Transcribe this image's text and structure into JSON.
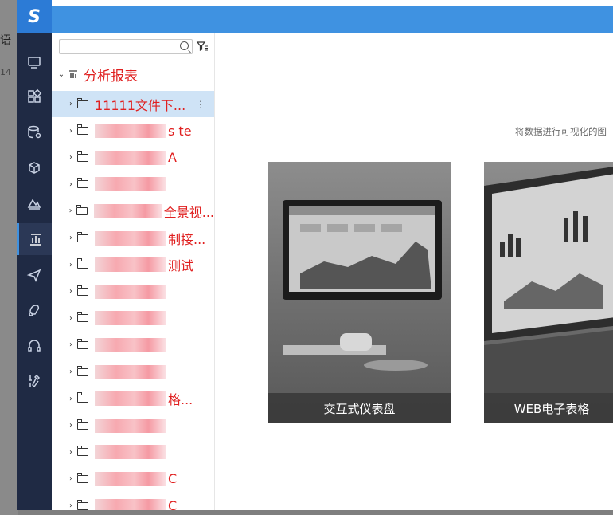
{
  "backdrop": {
    "glyph": "语",
    "small": "14"
  },
  "logo": {
    "text": "S"
  },
  "nav": [
    {
      "icon": "monitor-icon"
    },
    {
      "icon": "grid-icon"
    },
    {
      "icon": "database-icon"
    },
    {
      "icon": "cube-icon"
    },
    {
      "icon": "mountain-icon"
    },
    {
      "icon": "bar-chart-icon"
    },
    {
      "icon": "send-icon"
    },
    {
      "icon": "hand-icon"
    },
    {
      "icon": "headset-icon"
    },
    {
      "icon": "tools-icon"
    }
  ],
  "tree": {
    "search_value": "",
    "root_label": "分析报表",
    "items": [
      {
        "label": "11111文件下...",
        "selected": true
      },
      {
        "label": "s  te"
      },
      {
        "label": "A"
      },
      {
        "label": ""
      },
      {
        "label": "全景视..."
      },
      {
        "label": "制接..."
      },
      {
        "label": "测试"
      },
      {
        "label": ""
      },
      {
        "label": ""
      },
      {
        "label": ""
      },
      {
        "label": ""
      },
      {
        "label": "格..."
      },
      {
        "label": ""
      },
      {
        "label": ""
      },
      {
        "label": "C"
      },
      {
        "label": "C"
      }
    ]
  },
  "content": {
    "subtitle": "将数据进行可视化的图",
    "cards": [
      {
        "caption": "交互式仪表盘"
      },
      {
        "caption": "WEB电子表格"
      }
    ]
  },
  "colors": {
    "accent": "#3f92e1",
    "nav_bg": "#1f2a44",
    "tree_text": "#e02020",
    "selected_row": "#cfe3f6"
  }
}
